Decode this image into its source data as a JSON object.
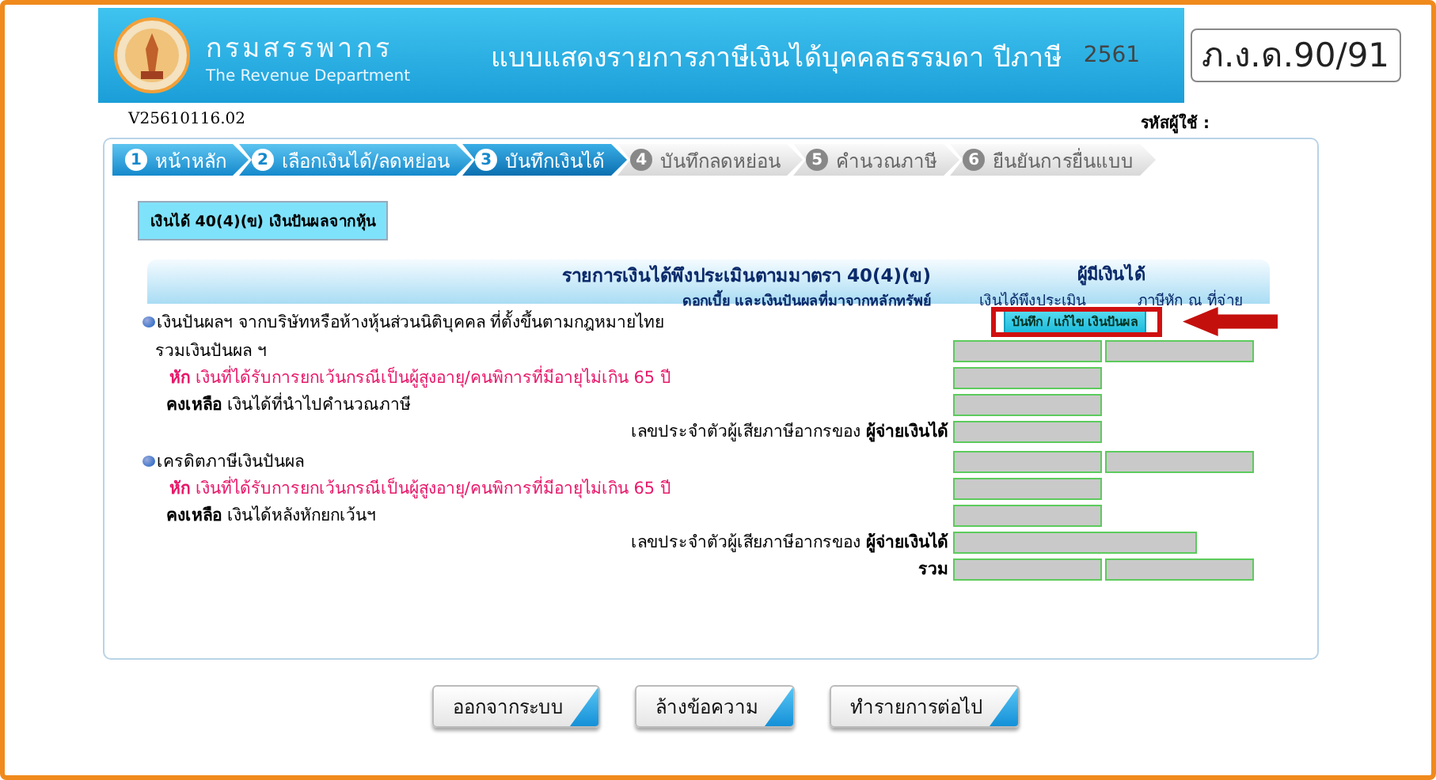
{
  "header": {
    "org_name": "กรมสรรพากร",
    "org_name_en": "The Revenue Department",
    "title": "แบบแสดงรายการภาษีเงินได้บุคคลธรรมดา ปีภาษี",
    "year": "2561",
    "form_code": "ภ.ง.ด.90/91"
  },
  "version": "V25610116.02",
  "user_label": "รหัสผู้ใช้ :",
  "steps": [
    {
      "number": "1",
      "label": "หน้าหลัก",
      "active": true,
      "selected": false
    },
    {
      "number": "2",
      "label": "เลือกเงินได้/ลดหย่อน",
      "active": true,
      "selected": false
    },
    {
      "number": "3",
      "label": "บันทึกเงินได้",
      "active": true,
      "selected": true
    },
    {
      "number": "4",
      "label": "บันทึกลดหย่อน",
      "active": false,
      "selected": false
    },
    {
      "number": "5",
      "label": "คำนวณภาษี",
      "active": false,
      "selected": false
    },
    {
      "number": "6",
      "label": "ยืนยันการยื่นแบบ",
      "active": false,
      "selected": false
    }
  ],
  "tabs": [
    {
      "label": "เงินได้ 40(4)(ข) เงินปันผลจากหุ้น",
      "selected": true
    }
  ],
  "table_header": {
    "title": "รายการเงินได้พึงประเมินตามมาตรา 40(4)(ข)",
    "subtitle": "ดอกเบี้ย และเงินปันผลที่มาจากหลักทรัพย์",
    "payee": "ผู้มีเงินได้",
    "column_1": "เงินได้พึงประเมิน",
    "column_2": "ภาษีหัก ณ ที่จ่าย"
  },
  "sections": [
    {
      "title": "เงินปันผลฯ จากบริษัทหรือห้างหุ้นส่วนนิติบุคคล ที่ตั้งขึ้นตามกฎหมายไทย",
      "button": {
        "label": "บันทึก / แก้ไข เงินปันผล",
        "highlighted": true
      },
      "rows": [
        {
          "kind": "sum",
          "label": "รวมเงินปันผล ฯ",
          "fields": [
            {
              "kind": "amount"
            },
            {
              "kind": "amount"
            }
          ]
        },
        {
          "kind": "deduct",
          "label": "**หัก** เงินที่ได้รับการยกเว้นกรณีเป็นผู้สูงอายุ/คนพิการที่มีอายุไม่เกิน 65 ปี",
          "fields": [
            {
              "kind": "amount"
            }
          ]
        },
        {
          "kind": "remain",
          "label": "**คงเหลือ**  เงินได้ที่นำไปคำนวณภาษี",
          "fields": [
            {
              "kind": "amount"
            }
          ]
        },
        {
          "kind": "taxid",
          "label": "เลขประจำตัวผู้เสียภาษีอากรของ **ผู้จ่ายเงินได้**",
          "fields": [
            {
              "kind": "amount"
            }
          ]
        }
      ]
    },
    {
      "title": "เครดิตภาษีเงินปันผล",
      "fields": [
        {
          "kind": "amount"
        },
        {
          "kind": "amount"
        }
      ],
      "rows": [
        {
          "kind": "deduct",
          "label": "**หัก** เงินที่ได้รับการยกเว้นกรณีเป็นผู้สูงอายุ/คนพิการที่มีอายุไม่เกิน 65 ปี",
          "fields": [
            {
              "kind": "amount"
            }
          ]
        },
        {
          "kind": "remain",
          "label": "**คงเหลือ**  เงินได้หลังหักยกเว้นฯ",
          "fields": [
            {
              "kind": "amount"
            }
          ]
        },
        {
          "kind": "taxid",
          "label": "เลขประจำตัวผู้เสียภาษีอากรของ **ผู้จ่ายเงินได้**",
          "fields": [
            {
              "kind": "taxid"
            }
          ]
        },
        {
          "kind": "total",
          "label": "รวม",
          "fields": [
            {
              "kind": "amount"
            },
            {
              "kind": "amount"
            }
          ]
        }
      ]
    }
  ],
  "buttons": [
    "ออกจากระบบ",
    "ล้างข้อความ",
    "ทำรายการต่อไป"
  ]
}
